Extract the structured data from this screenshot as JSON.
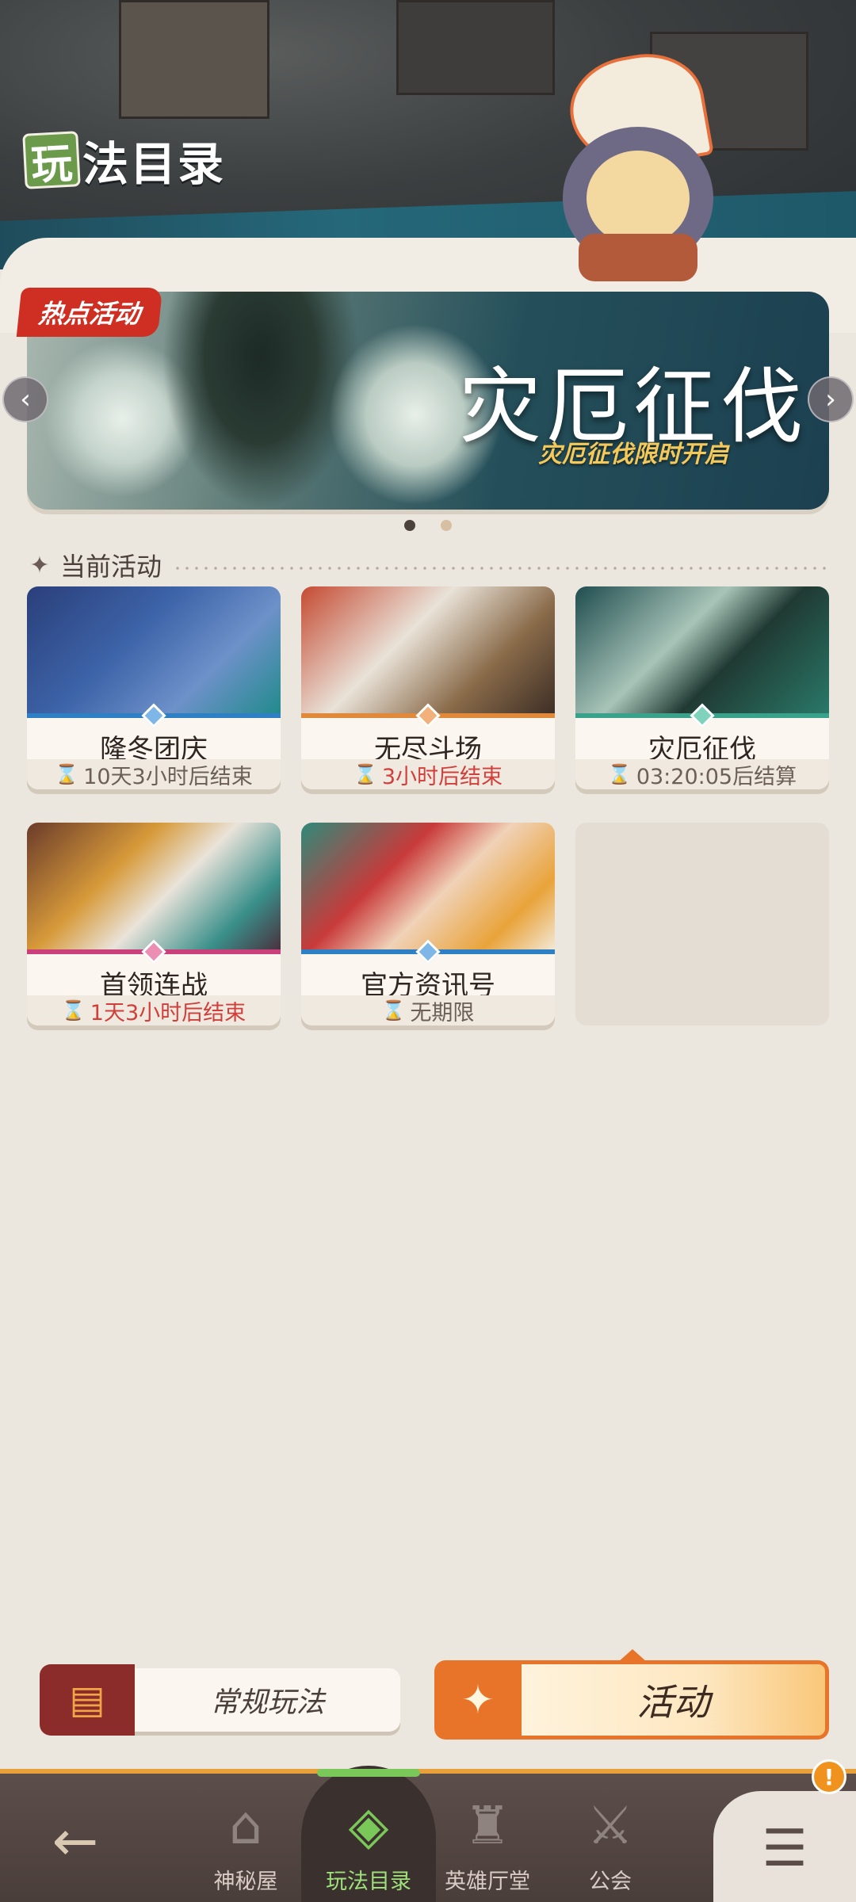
{
  "header": {
    "title_badge": "玩",
    "title_rest": "法目录"
  },
  "banner": {
    "tag": "热点活动",
    "title": "灾厄征伐",
    "subtitle": "灾厄征伐限时开启",
    "prev_icon": "‹",
    "next_icon": "›",
    "page_count": 2,
    "active_page": 1
  },
  "section": {
    "icon": "✦",
    "title": "当前活动"
  },
  "cards": [
    {
      "name": "隆冬团庆",
      "timer": "10天3小时后结束",
      "timer_red": false,
      "stripe": "#2f7fc4",
      "diamond": "#7fb6e8"
    },
    {
      "name": "无尽斗场",
      "timer": "3小时后结束",
      "timer_red": true,
      "stripe": "#e0893a",
      "diamond": "#f2b07a"
    },
    {
      "name": "灾厄征伐",
      "timer": "03:20:05后结算",
      "timer_red": false,
      "stripe": "#3aa18a",
      "diamond": "#7fd3bd"
    },
    {
      "name": "首领连战",
      "timer": "1天3小时后结束",
      "timer_red": true,
      "stripe": "#c9407a",
      "diamond": "#ec8db4"
    },
    {
      "name": "官方资讯号",
      "timer": "无期限",
      "timer_red": false,
      "stripe": "#2f7fc4",
      "diamond": "#7fb6e8"
    }
  ],
  "hourglass": "⌛",
  "mode_buttons": {
    "regular": {
      "label": "常规玩法",
      "icon": "▤"
    },
    "activity": {
      "label": "活动",
      "icon": "✦"
    }
  },
  "nav": {
    "back_icon": "←",
    "items": [
      {
        "label": "神秘屋",
        "icon": "⌂"
      },
      {
        "label": "玩法目录",
        "icon": "◈"
      },
      {
        "label": "英雄厅堂",
        "icon": "♜"
      },
      {
        "label": "公会",
        "icon": "⚔"
      }
    ],
    "menu_icon": "☰",
    "alert": "!"
  }
}
